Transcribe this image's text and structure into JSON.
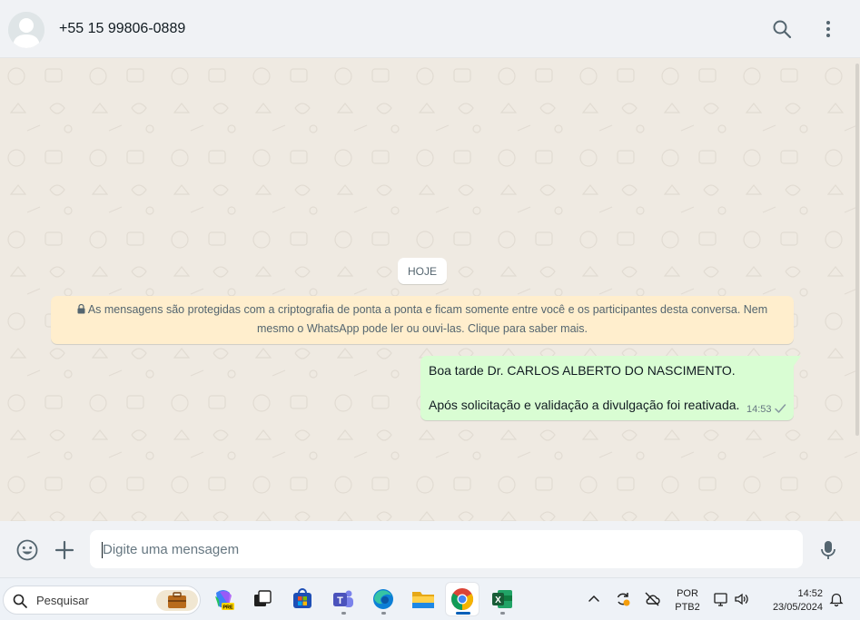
{
  "header": {
    "contact_name": "+55 15 99806-0889"
  },
  "chat": {
    "date_chip": "HOJE",
    "encryption_notice": {
      "line1": "As mensagens são protegidas com a criptografia de ponta a ponta e ficam somente entre você e os participantes desta conversa. Nem",
      "line2": "mesmo o WhatsApp pode ler ou ouvi-las. Clique para saber mais."
    },
    "messages": [
      {
        "direction": "outgoing",
        "line1": "Boa tarde Dr. CARLOS ALBERTO DO NASCIMENTO.",
        "line2": "Após solicitação e validação a divulgação foi reativada.",
        "time": "14:53",
        "status": "sent-single-check"
      }
    ]
  },
  "composer": {
    "placeholder": "Digite uma mensagem",
    "value": ""
  },
  "taskbar": {
    "search_label": "Pesquisar",
    "apps": [
      "copilot",
      "task-view",
      "microsoft-store",
      "teams",
      "edge",
      "file-explorer",
      "chrome",
      "excel"
    ],
    "active_app": "chrome",
    "language_line1": "POR",
    "language_line2": "PTB2",
    "time": "14:52",
    "date": "23/05/2024"
  },
  "colors": {
    "header_bg": "#f0f2f5",
    "chat_bg": "#efeae2",
    "outgoing_bubble": "#d9fdd3",
    "encryption_bg": "#ffeecd",
    "icon_gray": "#54656f"
  }
}
